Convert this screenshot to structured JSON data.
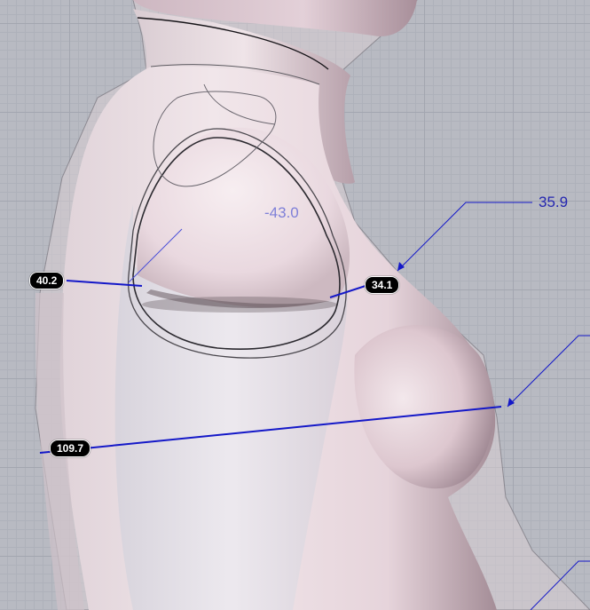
{
  "measurements": {
    "arm_hole_depth": "40.2",
    "shoulder_front": "34.1",
    "chest": "109.7",
    "leader_top_right": "35.9",
    "shoulder_angle": "-43.0"
  },
  "colors": {
    "dimension_line": "#1418c8",
    "tag_background": "#000000",
    "tag_text": "#ffffff",
    "body_fill": "#eadde2",
    "grid": "#a3a6b0"
  }
}
